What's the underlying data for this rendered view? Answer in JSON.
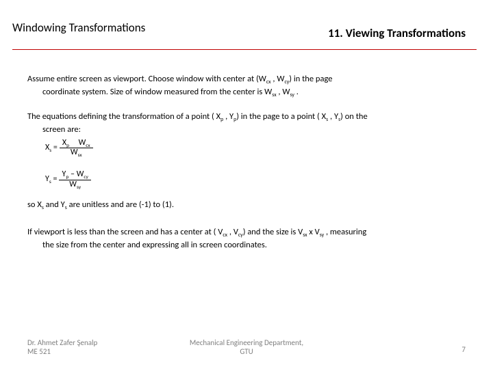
{
  "header": {
    "left_title": "Windowing Transformations",
    "right_title": "11. Viewing Transformations"
  },
  "body": {
    "subs": {
      "W": "W",
      "Wcx_open": "(W",
      "X": "X",
      "Y": "Y",
      "V": "V",
      "cx": "cx",
      "cy": "cy",
      "sx": "sx",
      "sy": "sy",
      "p": "p",
      "s": "s"
    },
    "p1": {
      "t1": "Assume entire screen as viewport. Choose window with center at ",
      "t2": " , ",
      "t3": ") in the page",
      "t4": "coordinate system. Size of window measured from the center is ",
      "t5": " , ",
      "t6": " ."
    },
    "p2": {
      "t1": "The equations defining the transformation of a point (",
      "t2": " , ",
      "t3": ") in the page to a point (",
      "t4": " , ",
      "t5": ") on the",
      "t6": "screen are:"
    },
    "eq": {
      "lhs_x": "X",
      "lhs_y": "Y",
      "eq": " = ",
      "minus": " – "
    },
    "p3": {
      "t1": "so ",
      "t2": " and ",
      "t3": " are unitless and are (-1) to (1)."
    },
    "p4": {
      "t1": "If viewport is less than the screen and has a center at (",
      "t2": " , ",
      "t3": ") and the size is ",
      "t4": " x ",
      "t5": " , measuring",
      "t6": "the size from the center and expressing all in screen coordinates."
    }
  },
  "footer": {
    "author_line1": "Dr. Ahmet Zafer Şenalp",
    "author_line2": "ME 521",
    "dept_line1": "Mechanical Engineering Department,",
    "dept_line2": "GTU",
    "page": "7"
  }
}
